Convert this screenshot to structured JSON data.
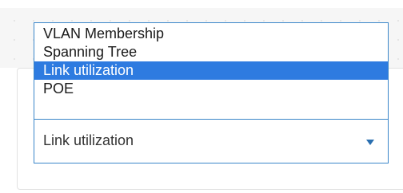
{
  "dropdown": {
    "options": [
      {
        "label": "VLAN Membership"
      },
      {
        "label": "Spanning Tree"
      },
      {
        "label": "Link utilization"
      },
      {
        "label": "POE"
      }
    ],
    "selected_index": 2,
    "current_value": "Link utilization",
    "arrow_icon": "caret-down-icon"
  },
  "colors": {
    "accent": "#2e7be0",
    "border": "#3a86c9",
    "arrow": "#2a6fb0"
  }
}
